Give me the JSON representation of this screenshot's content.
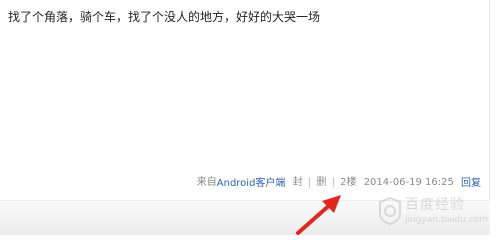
{
  "post": {
    "content": "找了个角落，骑个车，找了个没人的地方，好好的大哭一场"
  },
  "meta": {
    "source_prefix": "来自",
    "source_link": "Android客户端",
    "seal_label": "封",
    "delete_label": "删",
    "separator": "|",
    "floor": "2楼",
    "timestamp": "2014-06-19 16:25",
    "reply_label": "回复"
  },
  "watermark": {
    "brand": "百度经验",
    "url": "jingyan.baidu.com"
  },
  "colors": {
    "arrow": "#e3261c",
    "link": "#2d64b3",
    "meta_text": "#8a8a8a"
  },
  "icons": {
    "annotation": "red-arrow-icon",
    "watermark_logo": "baidu-seal-icon"
  }
}
